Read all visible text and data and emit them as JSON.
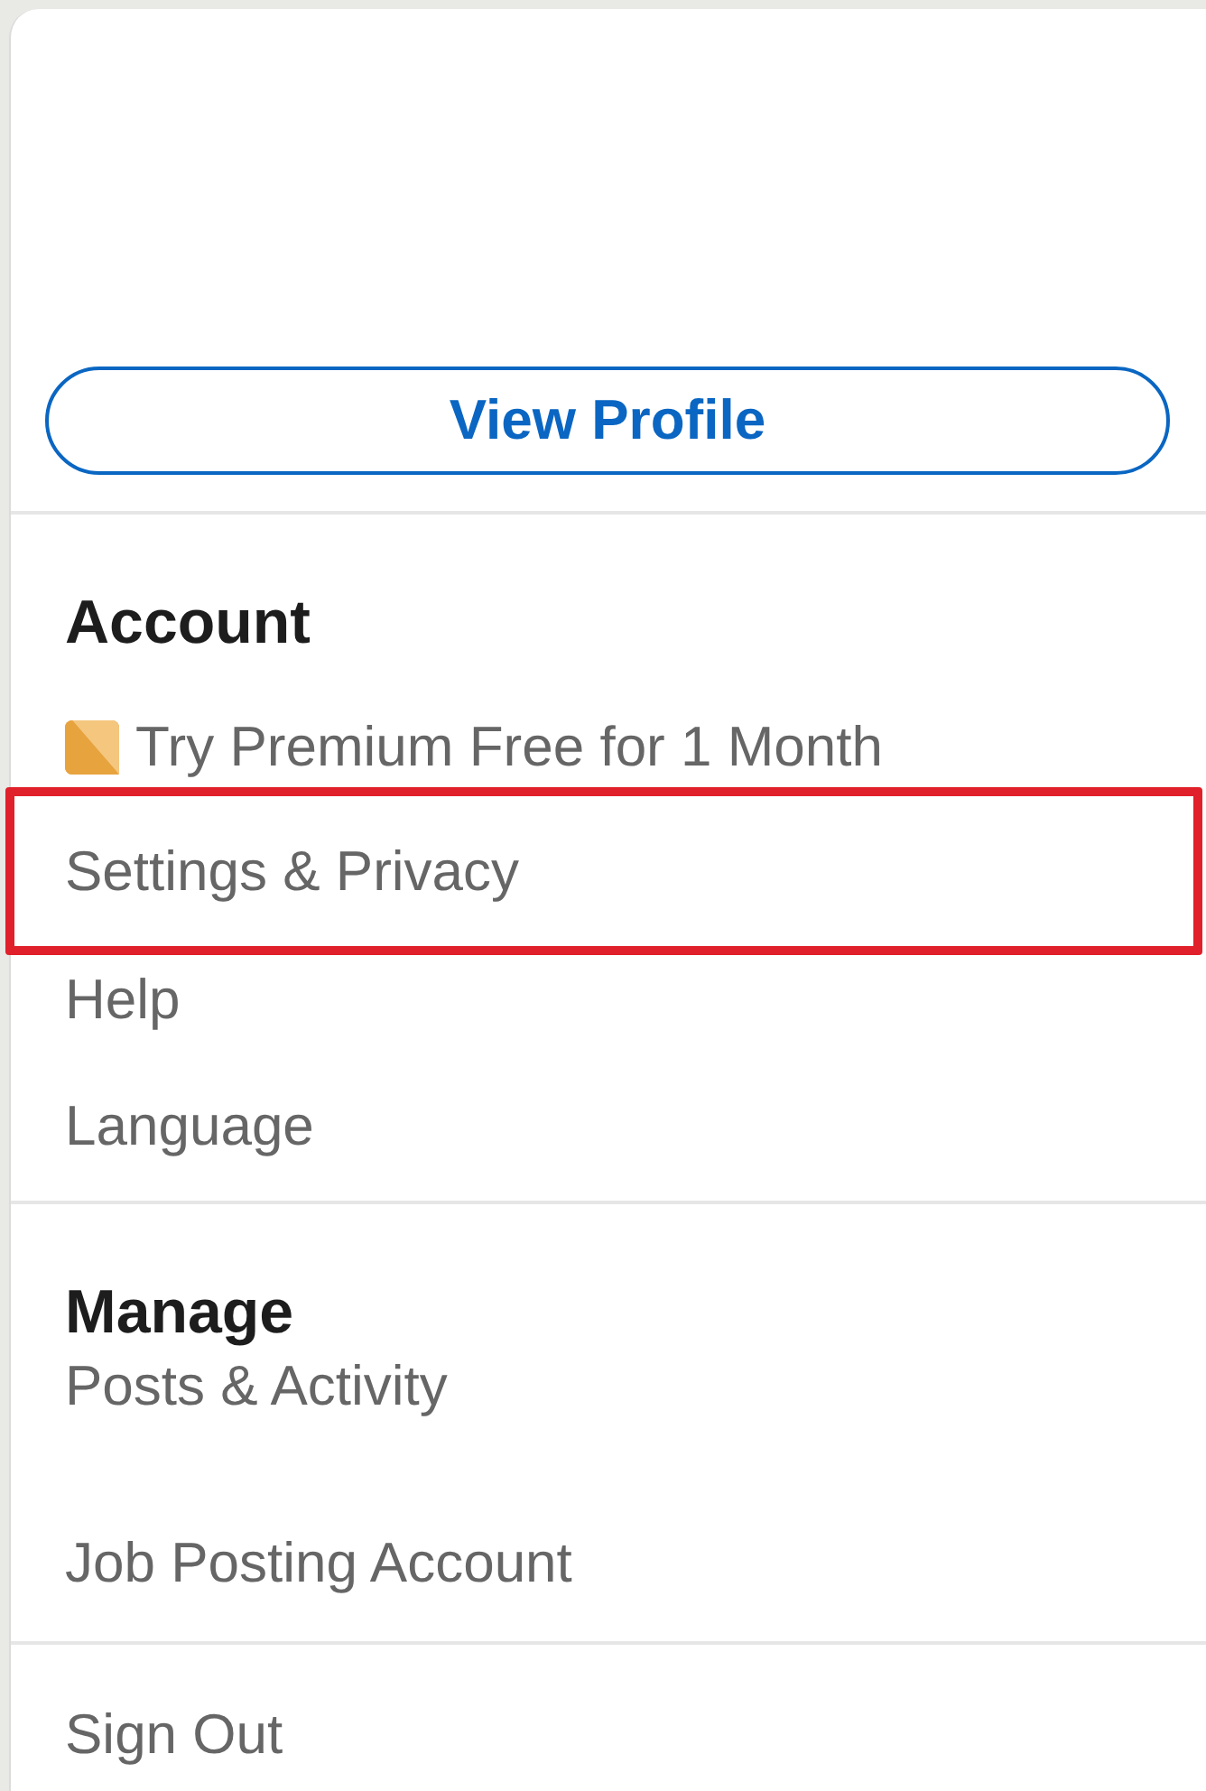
{
  "profile_button": {
    "label": "View Profile"
  },
  "sections": [
    {
      "heading": "Account",
      "kind": "account",
      "items": [
        {
          "label": "Try Premium Free for 1 Month",
          "kind": "premium",
          "highlighted": false
        },
        {
          "label": "Settings & Privacy",
          "kind": "plain",
          "highlighted": true
        },
        {
          "label": "Help",
          "kind": "plain",
          "highlighted": false
        },
        {
          "label": "Language",
          "kind": "plain",
          "highlighted": false
        }
      ]
    },
    {
      "heading": "Manage",
      "kind": "manage",
      "items": [
        {
          "label": "Posts & Activity",
          "kind": "plain",
          "highlighted": false
        },
        {
          "label": "Job Posting Account",
          "kind": "plain",
          "highlighted": false
        }
      ]
    }
  ],
  "sign_out": {
    "label": "Sign Out"
  }
}
